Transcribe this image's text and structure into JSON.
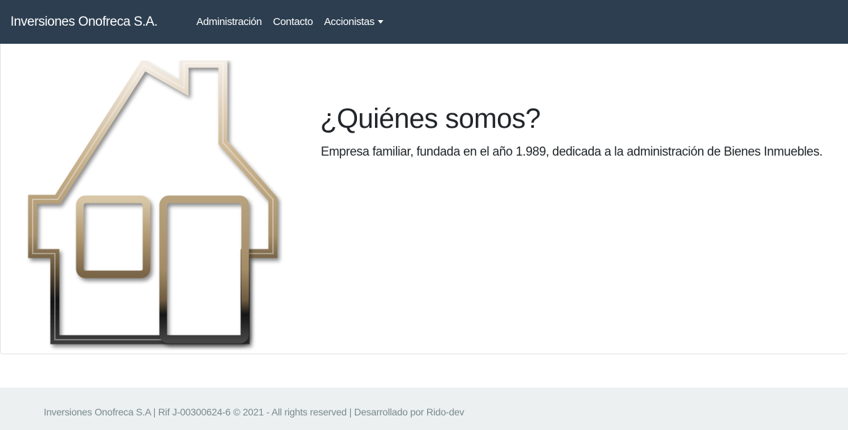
{
  "navbar": {
    "brand": "Inversiones Onofreca S.A.",
    "links": [
      {
        "label": "Administración"
      },
      {
        "label": "Contacto"
      },
      {
        "label": "Accionistas",
        "dropdown": true
      }
    ],
    "background": "#2c3e50"
  },
  "main": {
    "image_icon": "house-icon",
    "title": "¿Quiénes somos?",
    "description": "Empresa familiar, fundada en el año 1.989, dedicada a la administración de Bienes Inmuebles."
  },
  "footer": {
    "text": "Inversiones Onofreca S.A | Rif J-00300624-6 © 2021 - All rights reserved | Desarrollado por Rido-dev",
    "background": "#ecf0f1"
  }
}
